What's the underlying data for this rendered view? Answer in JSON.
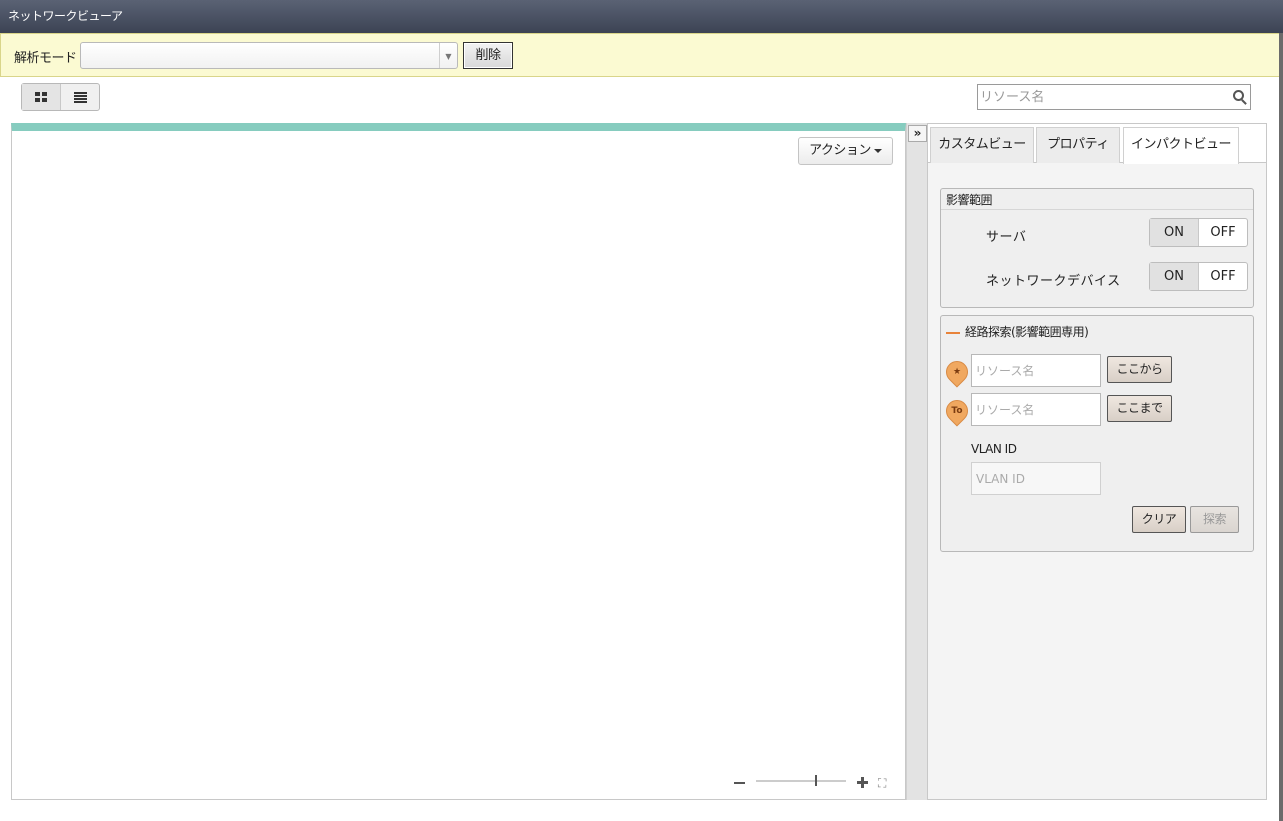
{
  "window": {
    "title": "ネットワークビューア"
  },
  "mode_bar": {
    "label": "解析モード",
    "selected": "",
    "delete_label": "削除"
  },
  "search": {
    "placeholder": "リソース名"
  },
  "canvas": {
    "action_label": "アクション"
  },
  "right_panel": {
    "tabs": [
      {
        "label": "カスタムビュー",
        "active": false
      },
      {
        "label": "プロパティ",
        "active": false
      },
      {
        "label": "インパクトビュー",
        "active": true
      }
    ],
    "impact": {
      "title": "影響範囲",
      "rows": [
        {
          "label": "サーバ",
          "on": "ON",
          "off": "OFF"
        },
        {
          "label": "ネットワークデバイス",
          "on": "ON",
          "off": "OFF"
        }
      ]
    },
    "route": {
      "title": "経路探索(影響範囲専用)",
      "from_pin": "★",
      "to_pin": "To",
      "from_placeholder": "リソース名",
      "to_placeholder": "リソース名",
      "from_button": "ここから",
      "to_button": "ここまで",
      "vlan_label": "VLAN ID",
      "vlan_placeholder": "VLAN ID",
      "clear_label": "クリア",
      "search_label": "探索"
    }
  },
  "colors": {
    "titlebar": "#3c4354",
    "mode_bar_bg": "#fbfad2",
    "canvas_accent": "#86ccbf",
    "route_dash": "#e8833a",
    "pin": "#f0a860"
  },
  "icons": {
    "grid_view": "grid-icon",
    "list_view": "list-icon",
    "search": "search-icon",
    "collapse": "double-chevron-right-icon",
    "zoom_out": "minus-icon",
    "zoom_in": "plus-icon",
    "fit": "fit-screen-icon"
  }
}
